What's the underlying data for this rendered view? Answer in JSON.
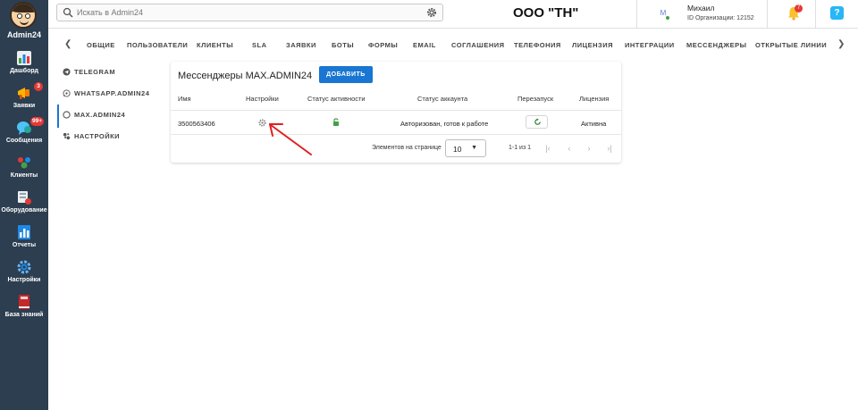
{
  "brand": {
    "name": "Admin24"
  },
  "sidebar": {
    "items": [
      {
        "label": "Дашборд",
        "icon": "dashboard-icon"
      },
      {
        "label": "Заявки",
        "icon": "megaphone-icon",
        "badge": "3"
      },
      {
        "label": "Сообщения",
        "icon": "chat-icon",
        "badge": "99+"
      },
      {
        "label": "Клиенты",
        "icon": "clients-icon"
      },
      {
        "label": "Оборудование",
        "icon": "equipment-icon"
      },
      {
        "label": "Отчеты",
        "icon": "reports-icon"
      },
      {
        "label": "Настройки",
        "icon": "gear-icon"
      },
      {
        "label": "База знаний",
        "icon": "book-icon"
      }
    ]
  },
  "header": {
    "search_placeholder": "Искать в Admin24",
    "org_title": "ООО \"ТН\"",
    "user_initial": "M",
    "user_name": "Михаил",
    "user_org": "ID Организации: 12152",
    "notifications_count": "7",
    "help_label": "?"
  },
  "tabs": {
    "items": [
      "ОБЩИЕ",
      "ПОЛЬЗОВАТЕЛИ",
      "КЛИЕНТЫ",
      "SLA",
      "ЗАЯВКИ",
      "БОТЫ",
      "ФОРМЫ",
      "EMAIL",
      "СОГЛАШЕНИЯ",
      "ТЕЛЕФОНИЯ",
      "ЛИЦЕНЗИЯ",
      "ИНТЕГРАЦИИ",
      "МЕССЕНДЖЕРЫ",
      "ОТКРЫТЫЕ ЛИНИИ"
    ]
  },
  "subnav": {
    "items": [
      {
        "label": "TELEGRAM",
        "icon": "telegram-icon",
        "active": false
      },
      {
        "label": "WHATSAPP.ADMIN24",
        "icon": "whatsapp-icon",
        "active": false
      },
      {
        "label": "MAX.ADMIN24",
        "icon": "max-icon",
        "active": true
      },
      {
        "label": "НАСТРОЙКИ",
        "icon": "settings-icon",
        "active": false
      }
    ]
  },
  "card": {
    "title": "Мессенджеры MAX.ADMIN24",
    "add_label": "ДОБАВИТЬ",
    "columns": [
      "Имя",
      "Настройки",
      "Статус активности",
      "Статус аккаунта",
      "Перезапуск",
      "Лицензия"
    ],
    "rows": [
      {
        "name": "3500563406",
        "account_status": "Авторизован, готов к работе",
        "license": "Активна"
      }
    ],
    "pagination": {
      "per_page_label": "Элементов на странице",
      "per_page_value": "10",
      "range": "1-1 из 1"
    }
  },
  "colors": {
    "sidebar": "#2c3e50",
    "primary": "#1976d2",
    "annotation_arrow": "#e02020",
    "active_lock": "#43a047"
  }
}
